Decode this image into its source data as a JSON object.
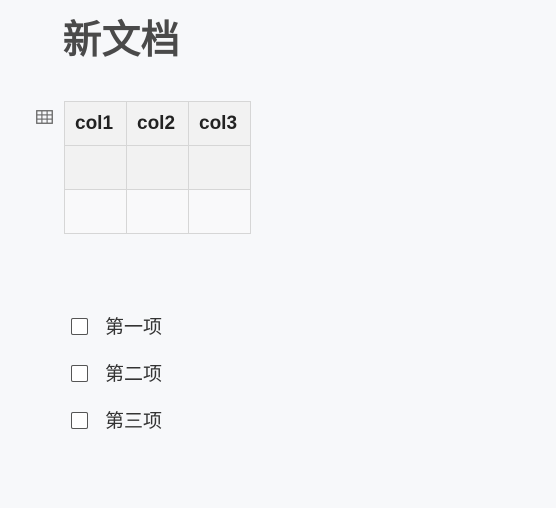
{
  "document": {
    "title": "新文档"
  },
  "table": {
    "headers": [
      "col1",
      "col2",
      "col3"
    ],
    "rows": [
      [
        "",
        "",
        ""
      ],
      [
        "",
        "",
        ""
      ]
    ]
  },
  "tasks": [
    {
      "label": "第一项",
      "checked": false
    },
    {
      "label": "第二项",
      "checked": false
    },
    {
      "label": "第三项",
      "checked": false
    }
  ],
  "icons": {
    "table_handle": "table-grid-icon"
  },
  "colors": {
    "background": "#f7f8fa",
    "title": "#4a4a4a",
    "table_border": "#d6d6d6",
    "table_header_bg": "#f2f2f2"
  }
}
